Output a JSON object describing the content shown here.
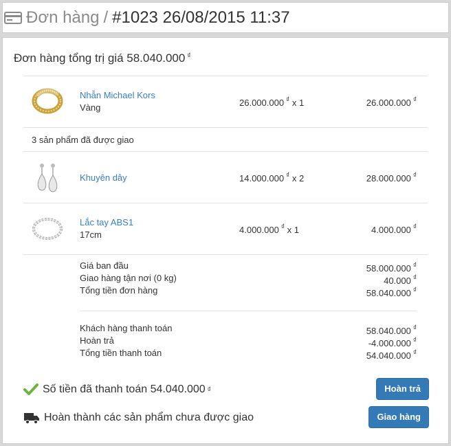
{
  "header": {
    "crumb": "Đơn hàng",
    "separator": "/",
    "order_ref": "#1023 26/08/2015 11:37"
  },
  "order": {
    "total_label": "Đơn hàng tổng trị giá 58.040.000",
    "currency": "₫"
  },
  "items": [
    {
      "name": "Nhẫn Michael Kors",
      "variant": "Vàng",
      "unit_price": "26.000.000",
      "qty": "x 1",
      "total": "26.000.000",
      "thumb_icon": "ring-icon"
    },
    {
      "name": "Khuyên dây",
      "variant": "",
      "unit_price": "14.000.000",
      "qty": "x 2",
      "total": "28.000.000",
      "thumb_icon": "earring-icon"
    },
    {
      "name": "Lắc tay ABS1",
      "variant": "17cm",
      "unit_price": "4.000.000",
      "qty": "x 1",
      "total": "4.000.000",
      "thumb_icon": "bracelet-icon"
    }
  ],
  "delivered_note": "3 sản phẩm đã được giao",
  "summary": {
    "subtotal_label": "Giá ban đầu",
    "subtotal": "58.000.000",
    "shipping_label": "Giao hàng tận nơi (0 kg)",
    "shipping": "40.000",
    "order_total_label": "Tổng tiền đơn hàng",
    "order_total": "58.040.000",
    "paid_label": "Khách hàng thanh toán",
    "paid": "58.040.000",
    "refund_label": "Hoàn trả",
    "refund": "-4.000.000",
    "net_label": "Tổng tiền thanh toán",
    "net": "54.040.000"
  },
  "status": {
    "paid_text": "Số tiền đã thanh toán 54.040.000",
    "fulfill_text": "Hoàn thành các sản phẩm chưa được giao",
    "refund_button": "Hoàn trả",
    "ship_button": "Giao hàng"
  },
  "colors": {
    "link": "#3a7fc1",
    "primary": "#337ab7",
    "check": "#6db33f"
  }
}
